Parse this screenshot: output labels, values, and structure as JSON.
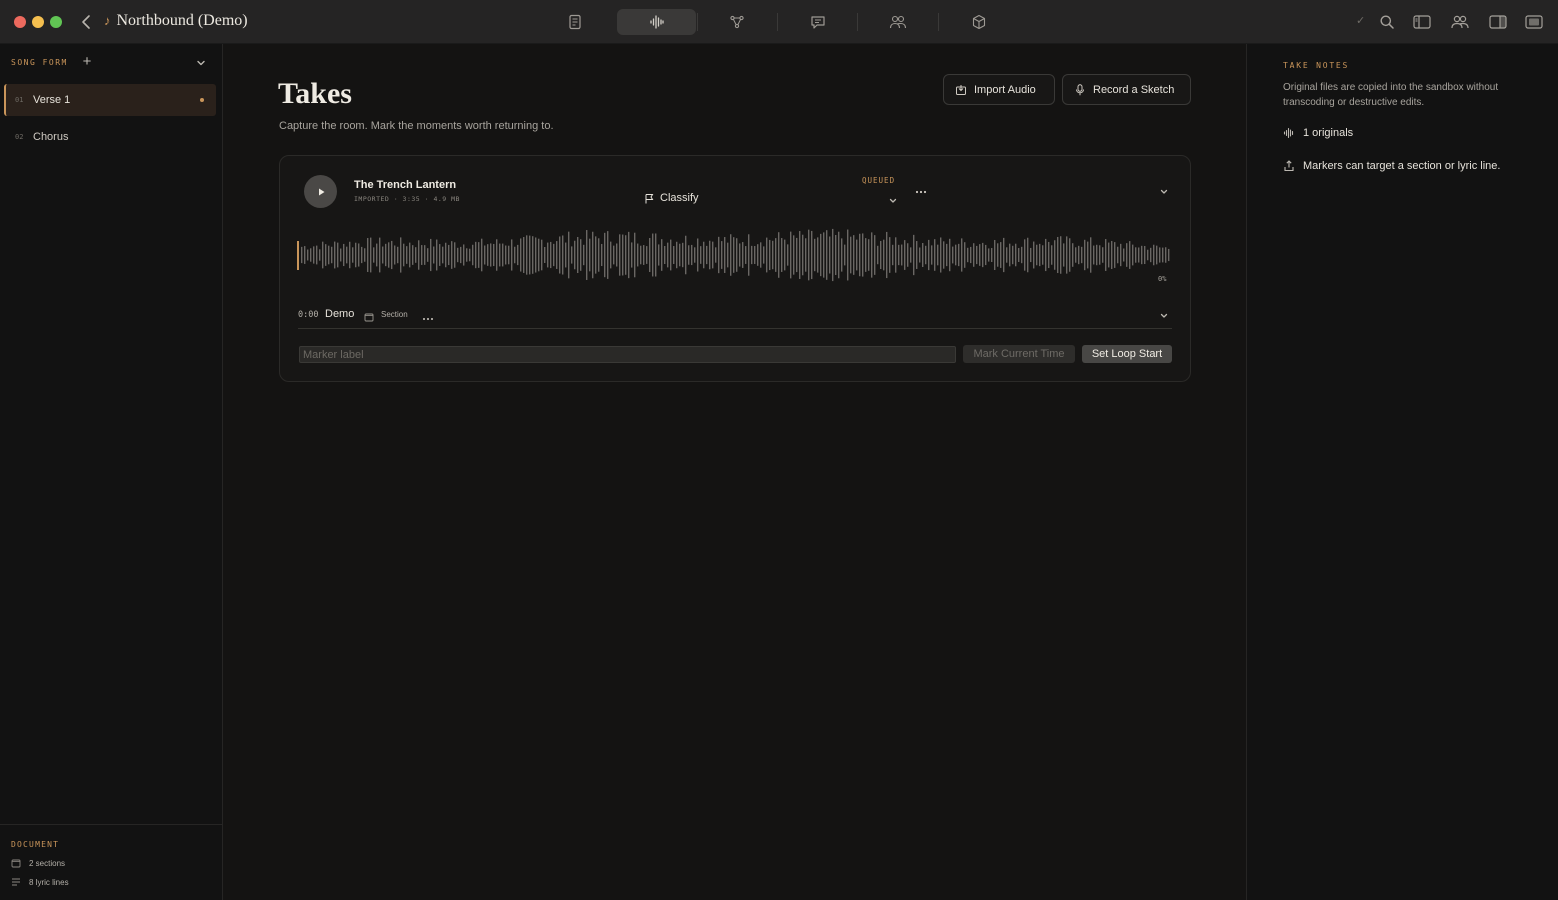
{
  "window": {
    "title": "Northbound (Demo)"
  },
  "toolbar": {
    "tabs": [
      "lyrics-icon",
      "audio-waveform-icon",
      "structure-icon",
      "comments-icon",
      "collaborators-icon",
      "package-icon"
    ],
    "active_tab": "audio-waveform-icon",
    "right_icons": [
      "checkmark-icon",
      "search-icon",
      "left-sidebar-icon",
      "people-icon",
      "right-sidebar-icon",
      "fullscreen-icon"
    ]
  },
  "sidebar": {
    "heading": "SONG FORM",
    "items": [
      {
        "num": "01",
        "label": "Verse 1",
        "active": true
      },
      {
        "num": "02",
        "label": "Chorus",
        "active": false
      }
    ],
    "footer": {
      "heading": "DOCUMENT",
      "sections": "2 sections",
      "lyric_lines": "8 lyric lines"
    }
  },
  "main": {
    "title": "Takes",
    "subtitle": "Capture the room. Mark the moments worth returning to.",
    "import_label": "Import Audio",
    "record_label": "Record a Sketch",
    "take": {
      "name": "The Trench Lantern",
      "meta": "IMPORTED · 3:35 · 4.9 MB",
      "classify_label": "Classify",
      "status": "QUEUED",
      "progress": "0%",
      "marker": {
        "time": "0:00",
        "name": "Demo",
        "section": "Section"
      },
      "marker_input_placeholder": "Marker label",
      "mark_time_label": "Mark Current Time",
      "loop_start_label": "Set Loop Start"
    }
  },
  "notes": {
    "heading": "TAKE NOTES",
    "description": "Original files are copied into the sandbox without transcoding or destructive edits.",
    "originals": "1 originals",
    "markers_note": "Markers can target a section or lyric line."
  },
  "colors": {
    "accent": "#c9955a",
    "background": "#141312",
    "panel": "#121212",
    "waveform": "#6a6764"
  }
}
